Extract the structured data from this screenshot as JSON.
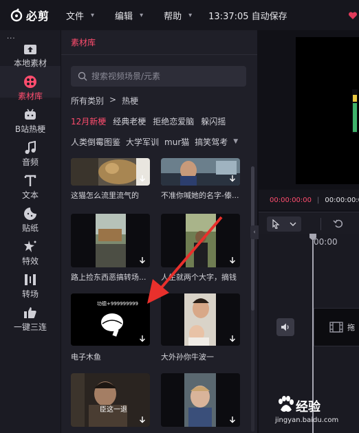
{
  "app": {
    "name": "必剪"
  },
  "menu": [
    {
      "label": "文件"
    },
    {
      "label": "编辑"
    },
    {
      "label": "帮助"
    }
  ],
  "status": {
    "clock": "13:37:05 自动保存"
  },
  "nav": {
    "more": "···",
    "items": [
      {
        "label": "本地素材",
        "icon": "upload-icon"
      },
      {
        "label": "素材库",
        "icon": "material-library-icon",
        "active": true
      },
      {
        "label": "B站热梗",
        "icon": "bilibili-tv-icon"
      },
      {
        "label": "音频",
        "icon": "music-note-icon"
      },
      {
        "label": "文本",
        "icon": "text-icon"
      },
      {
        "label": "贴纸",
        "icon": "sticker-icon"
      },
      {
        "label": "特效",
        "icon": "effects-star-icon"
      },
      {
        "label": "转场",
        "icon": "transition-icon"
      },
      {
        "label": "一键三连",
        "icon": "thumbs-up-icon"
      }
    ]
  },
  "library": {
    "tab": "素材库",
    "search_placeholder": "搜索视频场景/元素",
    "breadcrumb": {
      "root": "所有类别",
      "sep": ">",
      "current": "热梗"
    },
    "filters_row1": [
      "12月新梗",
      "经典老梗",
      "拒绝恋爱脑",
      "躲闪摇"
    ],
    "filters_row2": [
      "人类倒霉图鉴",
      "大学军训",
      "mur猫",
      "搞笑驾考"
    ],
    "cards": [
      {
        "caption": "这猫怎么流里流气的"
      },
      {
        "caption": "不准你喊她的名字-傣..."
      },
      {
        "caption": "路上捡东西恶搞转场..."
      },
      {
        "caption": "人生就两个大字，摘钱"
      },
      {
        "caption": "电子木鱼",
        "overlay": "功德+999999999"
      },
      {
        "caption": "大外孙你牛波一"
      },
      {
        "caption": "",
        "overlay": "臣这一退"
      },
      {
        "caption": ""
      }
    ]
  },
  "editor": {
    "time_current": "00:00:00:00",
    "time_sep": "|",
    "time_total": "00:00:00:00",
    "ruler_label": "00:00",
    "track_label": "拖"
  },
  "watermark": {
    "brand": "经验",
    "site": "jingyan.baidu.com"
  }
}
